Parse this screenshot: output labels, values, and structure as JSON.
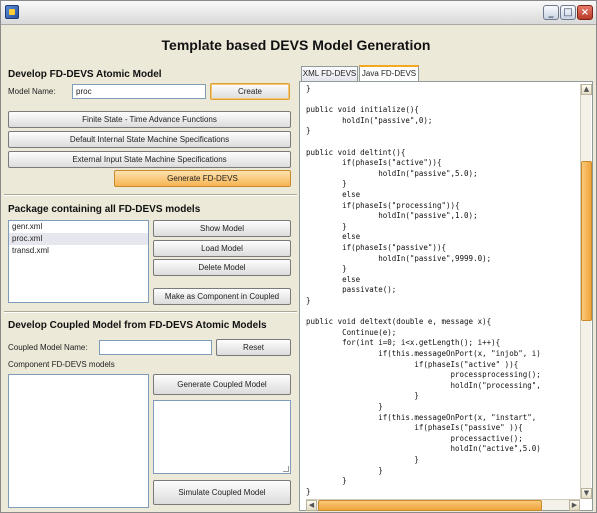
{
  "window": {
    "title": "",
    "controls": [
      "minimize-icon",
      "maximize-icon",
      "close-icon"
    ]
  },
  "header": {
    "title": "Template based DEVS Model Generation"
  },
  "atomic": {
    "section_title": "Develop FD-DEVS Atomic Model",
    "model_name_label": "Model Name:",
    "model_name_value": "proc",
    "create_label": "Create",
    "finite_state_label": "Finite State - Time Advance Functions",
    "internal_label": "Default Internal State Machine Specifications",
    "external_label": "External Input State Machine Specifications",
    "generate_label": "Generate FD-DEVS"
  },
  "package": {
    "section_title": "Package containing all FD-DEVS models",
    "models": [
      "genr.xml",
      "proc.xml",
      "transd.xml"
    ],
    "selected": "proc.xml",
    "show_label": "Show Model",
    "load_label": "Load Model",
    "delete_label": "Delete Model",
    "make_component_label": "Make as Component in Coupled"
  },
  "coupled": {
    "section_title": "Develop Coupled Model from FD-DEVS Atomic Models",
    "name_label": "Coupled Model Name:",
    "name_value": "",
    "reset_label": "Reset",
    "component_label": "Component FD-DEVS models",
    "generate_label": "Generate Coupled Model",
    "simulate_label": "Simulate Coupled Model"
  },
  "tabs": [
    {
      "label": "XML FD-DEVS",
      "active": false
    },
    {
      "label": "Java FD-DEVS",
      "active": true
    }
  ],
  "code_lines": [
    "}",
    "",
    "public void initialize(){",
    "        holdIn(\"passive\",0);",
    "}",
    "",
    "public void deltint(){",
    "        if(phaseIs(\"active\")){",
    "                holdIn(\"passive\",5.0);",
    "        }",
    "        else",
    "        if(phaseIs(\"processing\")){",
    "                holdIn(\"passive\",1.0);",
    "        }",
    "        else",
    "        if(phaseIs(\"passive\")){",
    "                holdIn(\"passive\",9999.0);",
    "        }",
    "        else",
    "        passivate();",
    "}",
    "",
    "public void deltext(double e, message x){",
    "        Continue(e);",
    "        for(int i=0; i<x.getLength(); i++){",
    "                if(this.messageOnPort(x, \"injob\", i)",
    "                        if(phaseIs(\"active\" )){",
    "                                processprocessing();",
    "                                holdIn(\"processing\",",
    "                        }",
    "                }",
    "                if(this.messageOnPort(x, \"instart\",",
    "                        if(phaseIs(\"passive\" )){",
    "                                processactive();",
    "                                holdIn(\"active\",5.0)",
    "                        }",
    "                }",
    "        }",
    "}"
  ],
  "colors": {
    "window_bg": "#ece9d8",
    "accent_orange": "#f6b452",
    "field_border": "#7f9db9"
  }
}
